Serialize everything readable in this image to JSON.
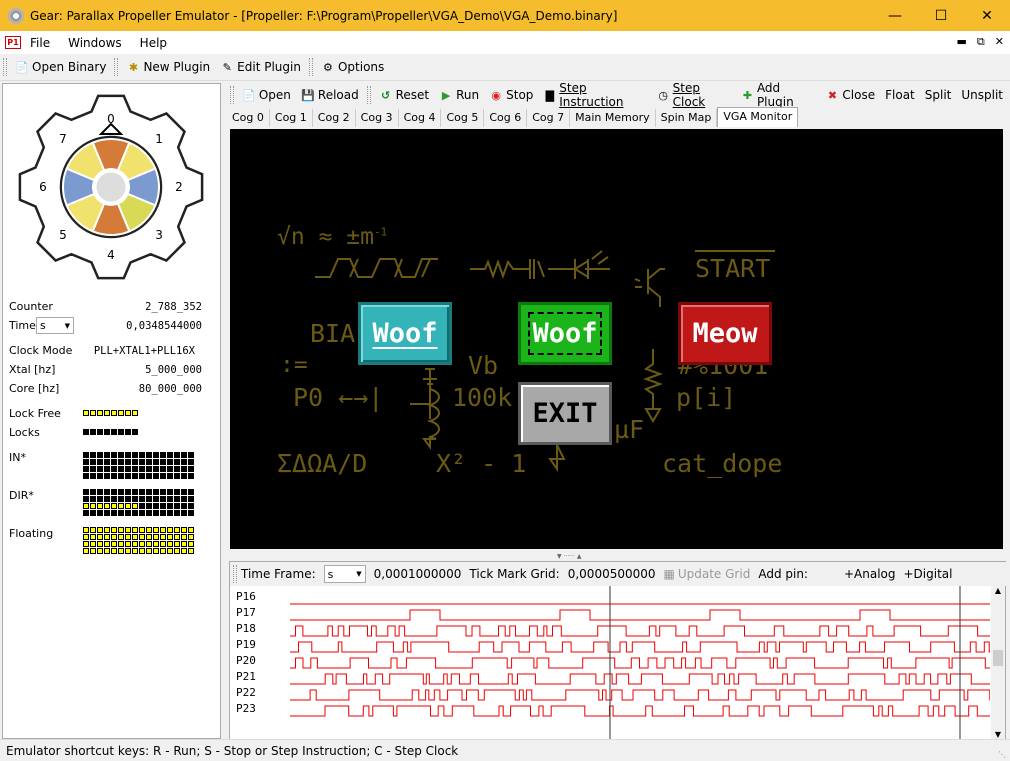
{
  "window": {
    "title": "Gear: Parallax Propeller Emulator - [Propeller: F:\\Program\\Propeller\\VGA_Demo\\VGA_Demo.binary]"
  },
  "menu": {
    "file": "File",
    "windows": "Windows",
    "help": "Help"
  },
  "toolbar": {
    "open_binary": "Open Binary",
    "new_plugin": "New Plugin",
    "edit_plugin": "Edit Plugin",
    "options": "Options"
  },
  "gear": {
    "cogs": [
      "0",
      "1",
      "2",
      "3",
      "4",
      "5",
      "6",
      "7"
    ],
    "segment_colors": [
      "#d57b3a",
      "#f1e26d",
      "#7b9bd0",
      "#d9d958",
      "#d57b3a",
      "#f1e26d",
      "#7b9bd0",
      "#f1e26d"
    ]
  },
  "info": {
    "counter_label": "Counter",
    "counter_value": "2_788_352",
    "time_label": "Time",
    "time_unit": "s",
    "time_value": "0,0348544000",
    "clock_mode_label": "Clock Mode",
    "clock_mode_value": "PLL+XTAL1+PLL16X",
    "xtal_label": "Xtal [hz]",
    "xtal_value": "5_000_000",
    "core_label": "Core [hz]",
    "core_value": "80_000_000",
    "lock_free_label": "Lock Free",
    "locks_label": "Locks",
    "in_label": "IN*",
    "dir_label": "DIR*",
    "floating_label": "Floating"
  },
  "emu_toolbar": {
    "open": "Open",
    "reload": "Reload",
    "reset": "Reset",
    "run": "Run",
    "stop": "Stop",
    "step_instruction": "Step Instruction",
    "step_clock": "Step Clock",
    "add_plugin": "Add Plugin",
    "close": "Close",
    "float": "Float",
    "split": "Split",
    "unsplit": "Unsplit"
  },
  "tabs": [
    "Cog 0",
    "Cog 1",
    "Cog 2",
    "Cog 3",
    "Cog 4",
    "Cog 5",
    "Cog 6",
    "Cog 7",
    "Main Memory",
    "Spin Map",
    "VGA Monitor"
  ],
  "active_tab": "VGA Monitor",
  "vga": {
    "formula1": "√n ≈ ±m",
    "formula1_sup": "-1",
    "start": "START",
    "bia": "BIA",
    "assign": ":=",
    "vb": "Vb",
    "p0": "P0 ←→|",
    "k100": "100k",
    "hash": "#%1001",
    "pi": "p[i]",
    "uf": "µF",
    "sigma": "ΣΔΩA/D",
    "x2": "X² - 1",
    "catdope": "cat_dope",
    "btn_woof1": "Woof",
    "btn_woof2": "Woof",
    "btn_meow": "Meow",
    "btn_exit": "EXIT",
    "colors": {
      "woof1": "#34b4b8",
      "woof2": "#1bb41b",
      "meow": "#c01818",
      "exit": "#a8a8a8",
      "olive": "#6b5a14"
    }
  },
  "bottom": {
    "time_frame_label": "Time Frame:",
    "time_frame_unit": "s",
    "time_frame_value": "0,0001000000",
    "tick_grid_label": "Tick Mark Grid:",
    "tick_grid_value": "0,0000500000",
    "update_grid": "Update Grid",
    "add_pin_label": "Add pin:",
    "analog": "+Analog",
    "digital": "+Digital",
    "pins": [
      "P16",
      "P17",
      "P18",
      "P19",
      "P20",
      "P21",
      "P22",
      "P23"
    ]
  },
  "status": {
    "text": "Emulator shortcut keys:  R - Run; S - Stop or Step Instruction; C - Step Clock"
  }
}
